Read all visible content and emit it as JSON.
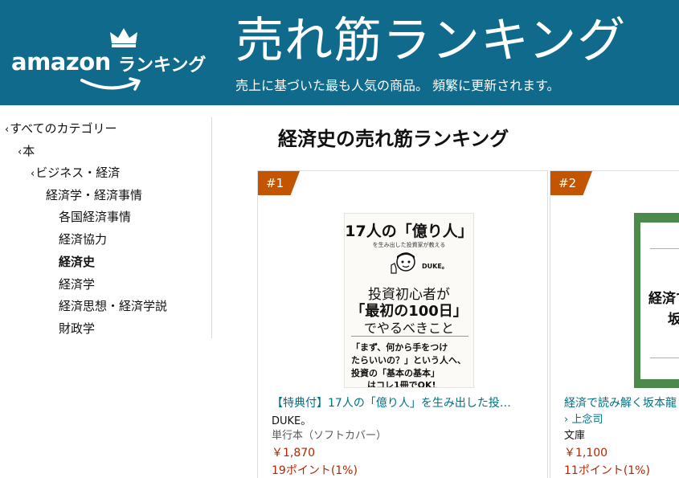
{
  "header": {
    "logo_word": "amazon",
    "logo_rank": "ランキング",
    "title": "売れ筋ランキング",
    "subtitle": "売上に基づいた最も人気の商品。 頻繁に更新されます。",
    "banner_color": "#0f6a8c"
  },
  "sidebar": {
    "items": [
      {
        "label": "すべてのカテゴリー",
        "chevron": "‹"
      },
      {
        "label": "本",
        "chevron": "‹"
      },
      {
        "label": "ビジネス・経済",
        "chevron": "‹"
      },
      {
        "label": "経済学・経済事情",
        "chevron": ""
      },
      {
        "label": "各国経済事情",
        "chevron": ""
      },
      {
        "label": "経済協力",
        "chevron": ""
      },
      {
        "label": "経済史",
        "chevron": ""
      },
      {
        "label": "経済学",
        "chevron": ""
      },
      {
        "label": "経済思想・経済学説",
        "chevron": ""
      },
      {
        "label": "財政学",
        "chevron": ""
      }
    ]
  },
  "main": {
    "title": "経済史の売れ筋ランキング",
    "products": [
      {
        "rank": "#1",
        "title": "【特典付】17人の「億り人」を生み出した投…",
        "author": "DUKE。",
        "format": "単行本（ソフトカバー）",
        "price": "￥1,870",
        "points": "19ポイント(1%)",
        "cover": {
          "line1": "17人の「億り人」",
          "line2": "を生み出した投資家が教える",
          "author": "DUKE。",
          "t1": "投資初心者が",
          "t2": "「最初の100日」",
          "t3": "でやるべきこと",
          "q1": "「まず、何から手をつけ",
          "q2": "たらいいの？」という人へ、",
          "q3": "投資の「基本の基本」",
          "q4": "はコレ1冊でOK!"
        }
      },
      {
        "rank": "#2",
        "title": "経済で読み解く坂本龍",
        "author": "上念司",
        "format": "文庫",
        "price": "￥1,100",
        "points": "11ポイント(1%)",
        "cover": {
          "t1": "経済で",
          "t2": "坂"
        }
      }
    ]
  },
  "colors": {
    "badge": "#c45500",
    "link": "#007185",
    "price": "#b12704"
  }
}
